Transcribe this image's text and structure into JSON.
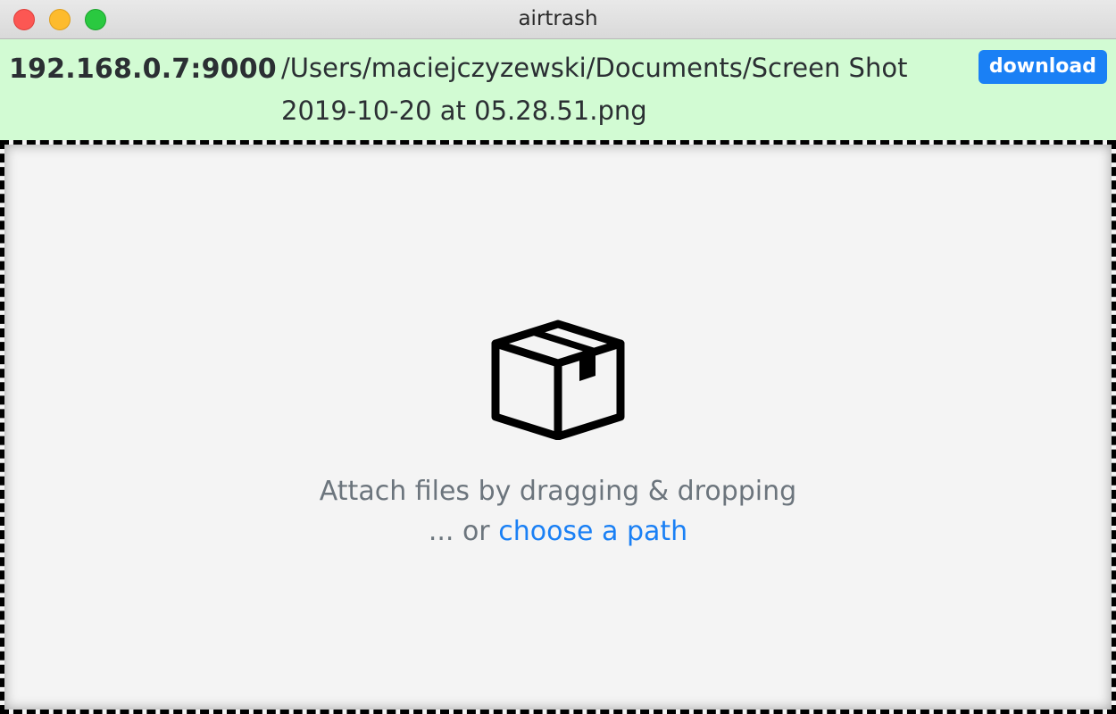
{
  "window": {
    "title": "airtrash"
  },
  "header": {
    "address": "192.168.0.7:9000",
    "file_path": "/Users/maciejczyzewski/Documents/Screen Shot 2019-10-20 at 05.28.51.png",
    "download_label": "download"
  },
  "dropzone": {
    "icon": "box-icon",
    "attach_text": "Attach files by dragging & dropping",
    "or_prefix": "... or",
    "choose_link": "choose a path"
  },
  "colors": {
    "header_bg": "#d2fbd3",
    "accent": "#1a80f5",
    "muted_text": "#6c757d"
  }
}
